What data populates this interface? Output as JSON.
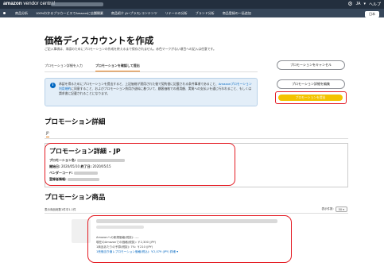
{
  "topbar": {
    "logo": "amazon",
    "logo_suffix": "vendor central",
    "lang": "JA",
    "help": "ヘルプ",
    "gear_icon": "gear-icon",
    "bg_color": "#232f3e"
  },
  "nav": {
    "items": [
      "商品分析",
      "100%わかるプラカ〜ビスでAmazonに店舗開業",
      "商品紹介 (A+プラス) コンテンツ",
      "リテールの分析",
      "ブランド分析",
      "商品登録の一括追加"
    ],
    "lang_button": "日本",
    "bg_color": "#37475a"
  },
  "page": {
    "title": "価格ディスカウントを作成",
    "subtitle": "ご記入事項は、承認のためにプロモーションの作成を終えるまで保存されません。赤色マークがない項目への記入は任意です。"
  },
  "steps": {
    "step1": "プロモーション詳細を入力",
    "step2": "プロモーションを確認して提出"
  },
  "actions": {
    "cancel": "プロモーションをキャンセル",
    "edit": "プロモーション詳細を編集",
    "submit": "プロモーションを提出",
    "submit_color": "#f3c300"
  },
  "info": {
    "icon": "info-icon",
    "text_before_link": "承認を得るためにプロモーションを提出すると、上記価格が適用された後で契約書に記載される条件事項であること、",
    "link": "Amazonプロモーション利用規約",
    "text_after_link": "に同意すること、およびプロモーション費用が送料に基づいて、顧客価格での適用額、実質への支払いを通じ行われること、もしくは請求書に記載されることになります。"
  },
  "details": {
    "section_title": "プロモーション詳細",
    "tab": "JP",
    "card_title": "プロモーション詳細 - JP",
    "name_label": "プロモーション名:",
    "period_start_label": "開始日:",
    "period_start": "2020/05/10",
    "period_end_label": "終了日:",
    "period_end": "2020/05/15",
    "vendor_code_label": "ベンダーコード:",
    "registered_label": "登録者情報:"
  },
  "goods": {
    "section_title": "プロモーション商品",
    "range_label": "表示商品総数1件中1-1件",
    "per_page_label": "表示件数:",
    "per_page_value": "50",
    "selling_price_line": "Amazonへの新規価格(税抜): ----",
    "current_price_line": "現在のAmazonでの価格(税抜): ￥2,300 (JPY)",
    "per_unit_line": "1商品あたりの予算(税抜): 7%: ￥210 (JPY)",
    "promo_price_line": "1売価当り値レプロモーション価格(税込): ￥2,079 (JPY) 詳細"
  }
}
